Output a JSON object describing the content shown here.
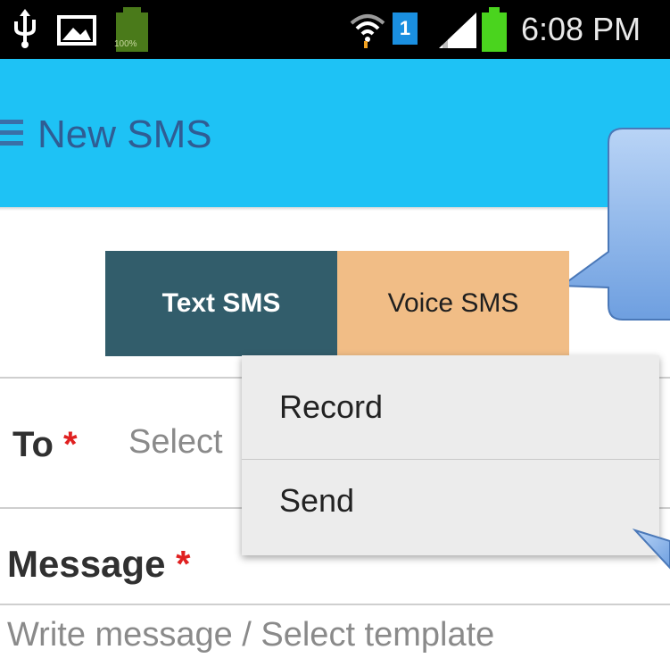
{
  "status_bar": {
    "battery_left_label": "100%",
    "sim_slot": "1",
    "time": "6:08 PM",
    "icons": [
      "usb-icon",
      "image-icon",
      "battery-icon",
      "wifi-icon",
      "sim-icon",
      "signal-icon",
      "battery-icon"
    ]
  },
  "app_bar": {
    "title": "New SMS",
    "color": "#1ec2f5"
  },
  "tabs": {
    "text_sms": "Text SMS",
    "voice_sms": "Voice SMS",
    "text_color": "#325d6b",
    "voice_color": "#f1bd86"
  },
  "form": {
    "to_label": "To",
    "to_required": "*",
    "to_placeholder": "Select",
    "message_label": "Message",
    "message_required": "*",
    "message_placeholder": "Write message / Select template"
  },
  "menu": {
    "items": [
      {
        "label": "Record"
      },
      {
        "label": "Send"
      }
    ]
  }
}
